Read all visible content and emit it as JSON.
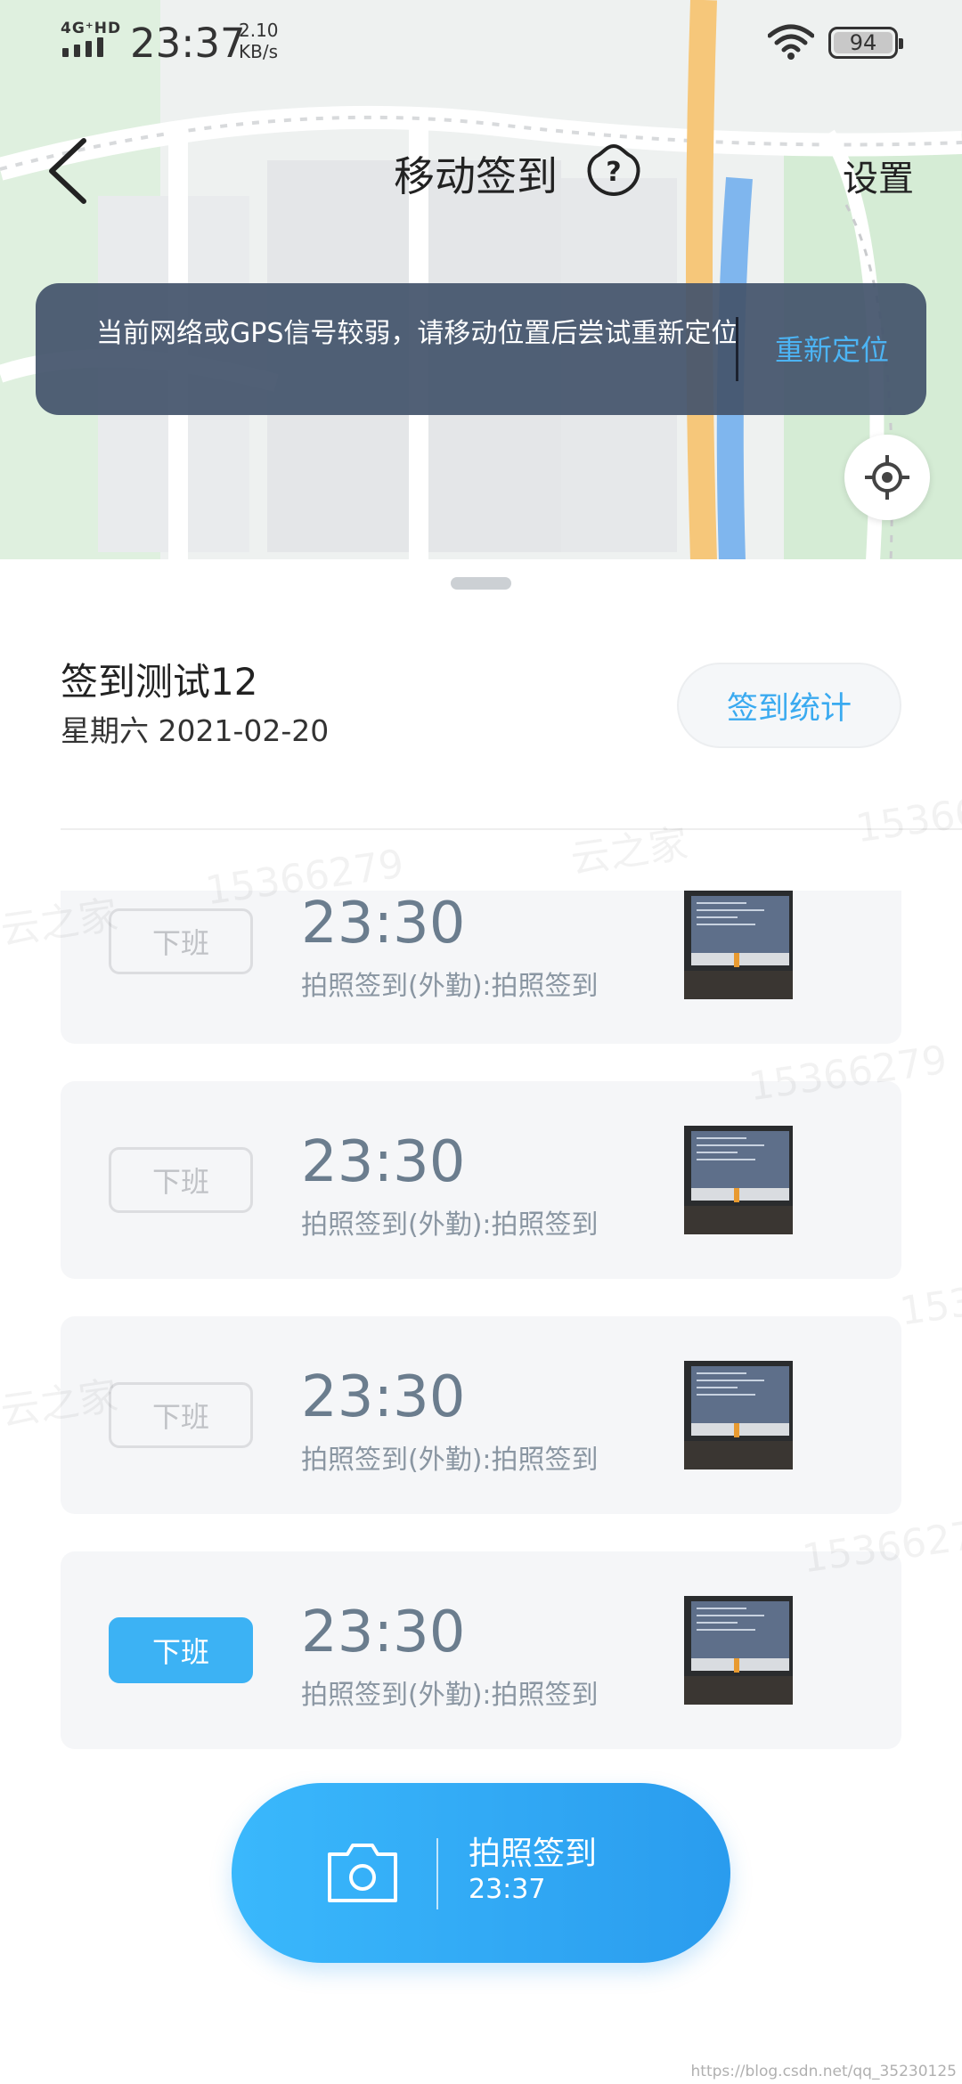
{
  "status_bar": {
    "network": "4G⁺HD",
    "time": "23:37",
    "speed_value": "2.10",
    "speed_unit": "KB/s",
    "battery": "94",
    "icons": [
      "signal-icon",
      "wifi-icon",
      "battery-icon"
    ]
  },
  "header": {
    "title": "移动签到",
    "settings_label": "设置",
    "icons": [
      "back-icon",
      "help-icon"
    ]
  },
  "toast": {
    "message": "当前网络或GPS信号较弱，请移动位置后尝试重新定位",
    "action_label": "重新定位"
  },
  "task": {
    "name": "签到测试12",
    "date": "星期六   2021-02-20",
    "stats_button_label": "签到统计"
  },
  "records": [
    {
      "tag": "下班",
      "time": "23:30",
      "desc": "拍照签到(外勤):拍照签到",
      "active": false
    },
    {
      "tag": "下班",
      "time": "23:30",
      "desc": "拍照签到(外勤):拍照签到",
      "active": false
    },
    {
      "tag": "下班",
      "time": "23:30",
      "desc": "拍照签到(外勤):拍照签到",
      "active": false
    },
    {
      "tag": "下班",
      "time": "23:30",
      "desc": "拍照签到(外勤):拍照签到",
      "active": true
    }
  ],
  "photo_checkin": {
    "label": "拍照签到",
    "time": "23:37"
  },
  "watermarks": [
    "15366279",
    "云之家",
    "15366279",
    "云之家",
    "15366279",
    "云之家",
    "1536",
    "15366279"
  ],
  "credit": "https://blog.csdn.net/qq_35230125",
  "colors": {
    "accent": "#3cb2f4",
    "toast_bg": "#44546c",
    "card_bg": "#f5f6f8",
    "time_text": "#6b7d8e"
  }
}
